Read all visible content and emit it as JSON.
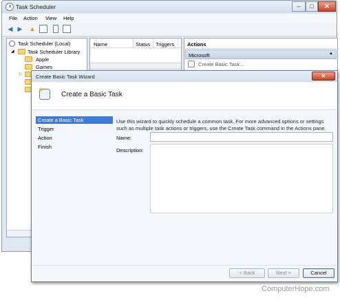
{
  "main_window": {
    "title": "Task Scheduler",
    "menu": [
      "File",
      "Action",
      "View",
      "Help"
    ],
    "controls": {
      "minimize": "–",
      "maximize": "□",
      "close": "✕"
    }
  },
  "tree": {
    "root": "Task Scheduler (Local)",
    "library": "Task Scheduler Library",
    "folders": [
      "Apple",
      "Games",
      "",
      "",
      ""
    ]
  },
  "task_list": {
    "columns": [
      "Name",
      "Status",
      "Triggers"
    ]
  },
  "actions_pane": {
    "header": "Actions",
    "section": "Microsoft",
    "items": [
      "Create Basic Task..."
    ]
  },
  "wizard": {
    "title": "Create Basic Task Wizard",
    "close": "✕",
    "heading": "Create a Basic Task",
    "steps": [
      "Create a Basic Task",
      "Trigger",
      "Action",
      "Finish"
    ],
    "selected_step": 0,
    "intro": "Use this wizard to quickly schedule a common task.  For more advanced options or settings such as multiple task actions or triggers, use the Create Task command in the Actions pane.",
    "name_label": "Name:",
    "name_value": "",
    "description_label": "Description:",
    "description_value": "",
    "buttons": {
      "back": "< Back",
      "next": "Next >",
      "cancel": "Cancel"
    }
  },
  "watermark": "ComputerHope.com",
  "colors": {
    "selection": "#3d7bd8",
    "close_button": "#c6432a",
    "folder": "#f4d57a"
  }
}
